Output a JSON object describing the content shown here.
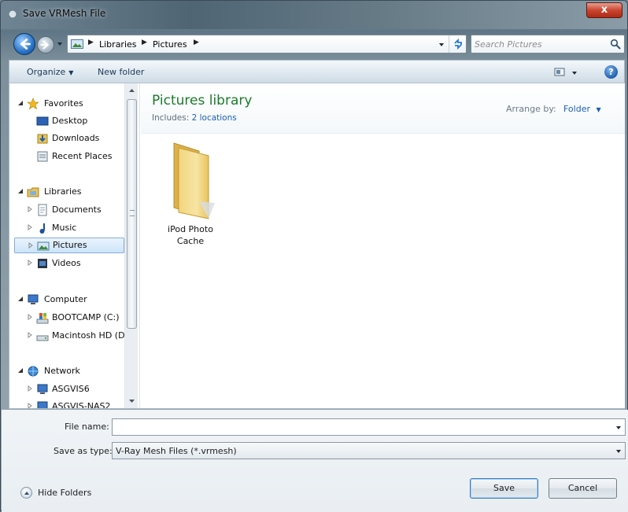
{
  "window": {
    "title": "Save VRMesh File",
    "close_label": "x"
  },
  "address": {
    "crumbs": [
      "Libraries",
      "Pictures"
    ],
    "separator": "▶"
  },
  "search": {
    "placeholder": "Search Pictures"
  },
  "toolbar": {
    "organize_label": "Organize",
    "new_folder_label": "New folder",
    "help_label": "?"
  },
  "nav": {
    "favorites": {
      "label": "Favorites",
      "items": [
        "Desktop",
        "Downloads",
        "Recent Places"
      ]
    },
    "libraries": {
      "label": "Libraries",
      "items": [
        "Documents",
        "Music",
        "Pictures",
        "Videos"
      ],
      "selected": "Pictures"
    },
    "computer": {
      "label": "Computer",
      "items": [
        "BOOTCAMP (C:)",
        "Macintosh HD (D"
      ]
    },
    "network": {
      "label": "Network",
      "items": [
        "ASGVIS6",
        "ASGVIS-NAS2"
      ]
    }
  },
  "library": {
    "title": "Pictures library",
    "includes_prefix": "Includes:",
    "includes_link": "2 locations",
    "arrange_label": "Arrange by:",
    "arrange_value": "Folder"
  },
  "files": [
    {
      "name_line1": "iPod Photo",
      "name_line2": "Cache",
      "icon": "folder-icon"
    }
  ],
  "form": {
    "file_name_label": "File name:",
    "file_name_value": "",
    "save_type_label": "Save as type:",
    "save_type_value": "V-Ray Mesh Files (*.vrmesh)"
  },
  "footer": {
    "hide_folders_label": "Hide Folders",
    "save_label": "Save",
    "cancel_label": "Cancel"
  },
  "colors": {
    "library_title": "#1b7b2a",
    "link": "#1a5fb4",
    "selection": "#cce4f9",
    "close": "#c9452f"
  }
}
